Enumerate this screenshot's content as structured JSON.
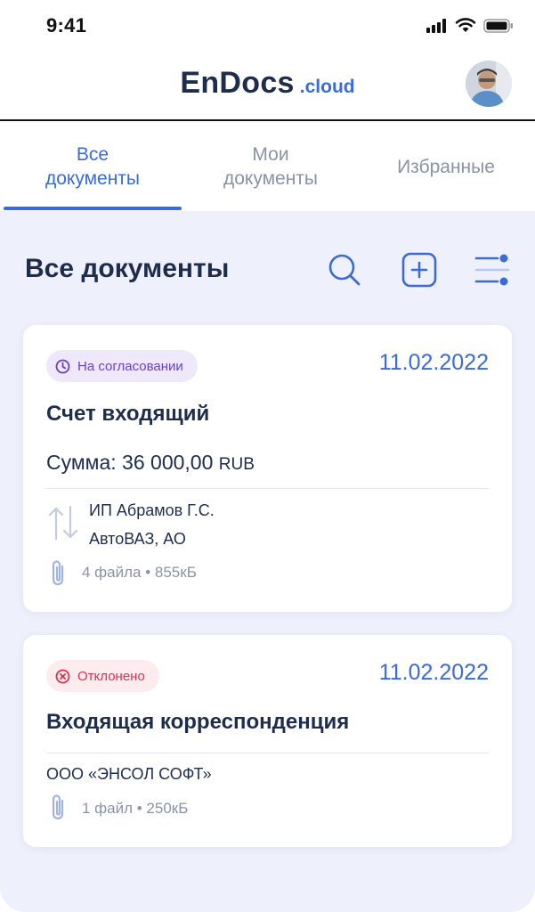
{
  "status_bar": {
    "time": "9:41"
  },
  "header": {
    "brand_main": "EnDocs",
    "brand_sub": ".cloud"
  },
  "tabs": [
    {
      "line1": "Все",
      "line2": "документы",
      "active": true
    },
    {
      "line1": "Мои",
      "line2": "документы",
      "active": false
    },
    {
      "line1": "Избранные",
      "line2": "",
      "active": false
    }
  ],
  "main": {
    "title": "Все документы"
  },
  "documents": [
    {
      "status": "На согласовании",
      "date": "11.02.2022",
      "title": "Счет входящий",
      "amount_label": "Сумма: 36 000,00",
      "currency": "RUB",
      "from": "ИП Абрамов Г.С.",
      "to": "АвтоВАЗ, АО",
      "files": "4 файла • 855кБ"
    },
    {
      "status": "Отклонено",
      "date": "11.02.2022",
      "title": "Входящая корреспонденция",
      "party": "ООО «ЭНСОЛ СОФТ»",
      "files": "1 файл • 250кБ"
    }
  ],
  "colors": {
    "accent": "#3a6bd9",
    "text": "#1f2d4d",
    "muted": "#8a93a6",
    "pending": "#6d3fc7",
    "rejected": "#d93250",
    "background": "#eef0fb"
  },
  "icons": [
    "signal-icon",
    "wifi-icon",
    "battery-icon",
    "search-icon",
    "add-icon",
    "filter-icon",
    "clock-icon",
    "reject-icon",
    "transfer-icon",
    "paperclip-icon"
  ]
}
